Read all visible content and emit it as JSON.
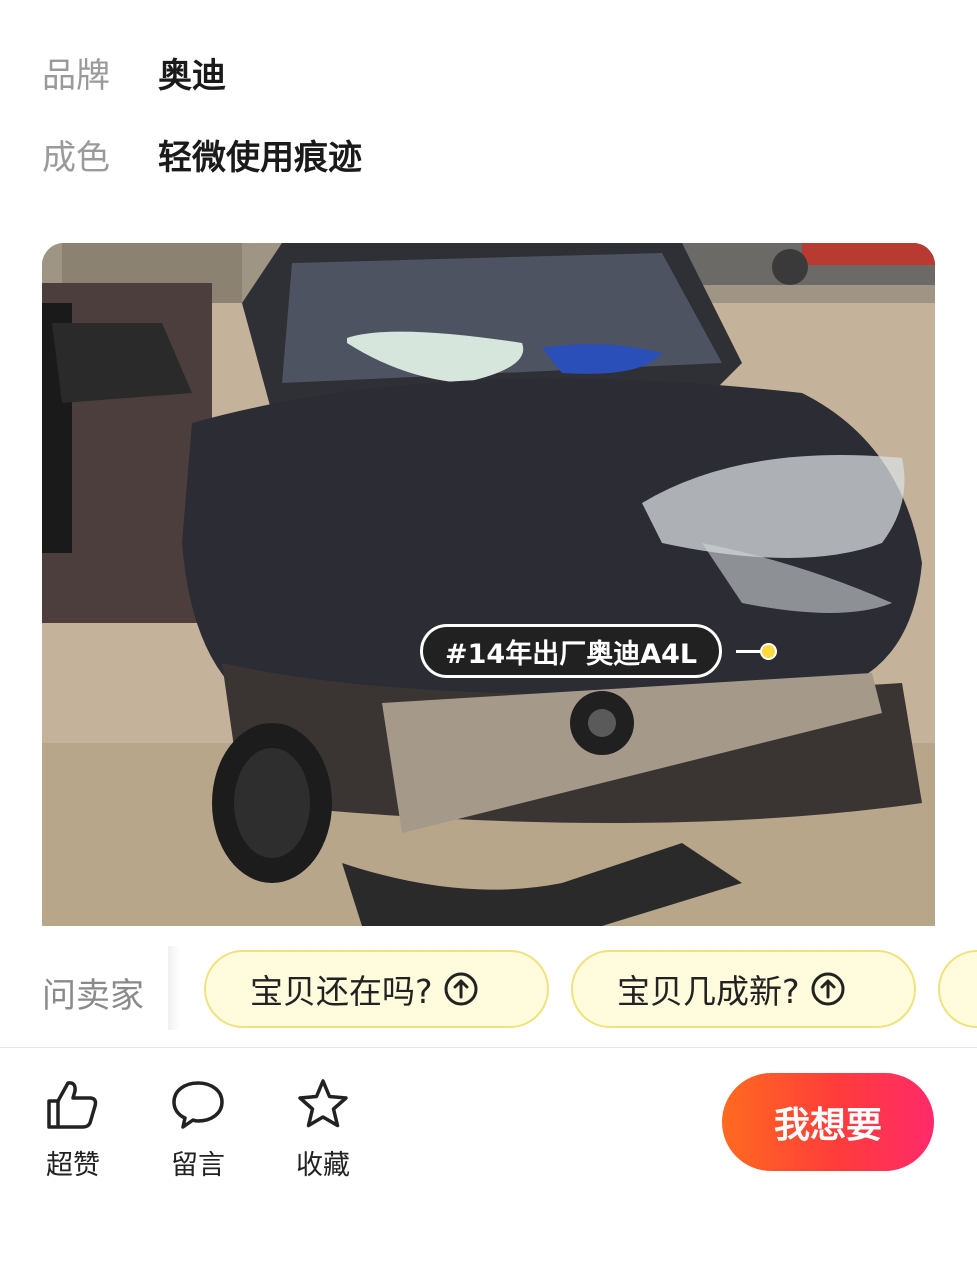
{
  "attributes": {
    "brand_label": "品牌",
    "brand_value": "奥迪",
    "condition_label": "成色",
    "condition_value": "轻微使用痕迹"
  },
  "photo": {
    "tag_text": "#14年出厂奥迪A4L",
    "tag_dot_color": "#ffd93d"
  },
  "ask_seller": {
    "label": "问卖家",
    "questions": [
      "宝贝还在吗?",
      "宝贝几成新?"
    ],
    "chip_icon": "arrow-up-circle-icon"
  },
  "actions": {
    "like_label": "超赞",
    "like_icon": "thumbs-up-icon",
    "comment_label": "留言",
    "comment_icon": "speech-bubble-icon",
    "favorite_label": "收藏",
    "favorite_icon": "star-icon",
    "want_button": "我想要"
  },
  "colors": {
    "want_gradient_start": "#ff6a1f",
    "want_gradient_end": "#ff2a6a",
    "chip_background": "#fffbdc"
  }
}
